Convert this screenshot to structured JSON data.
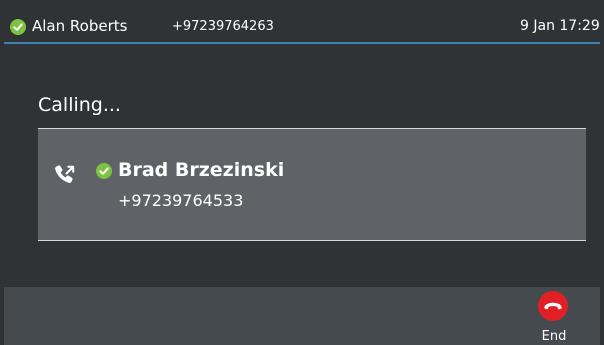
{
  "status_bar": {
    "user_name": "Alan Roberts",
    "user_number": "+97239764263",
    "date_time": "9 Jan 17:29",
    "presence_icon": "available-check-icon"
  },
  "call": {
    "state_label": "Calling...",
    "direction_icon": "outgoing-call-icon",
    "remote_name": "Brad Brzezinski",
    "remote_number": "+97239764533",
    "remote_presence_icon": "available-check-icon"
  },
  "softkeys": {
    "end_label": "End",
    "end_icon": "hang-up-icon"
  },
  "colors": {
    "background": "#2f3336",
    "card": "#5f6367",
    "softkey_bar": "#454a4e",
    "presence_available": "#7fc241",
    "end_button": "#e02024",
    "accent_line": "#3f7fb0"
  }
}
